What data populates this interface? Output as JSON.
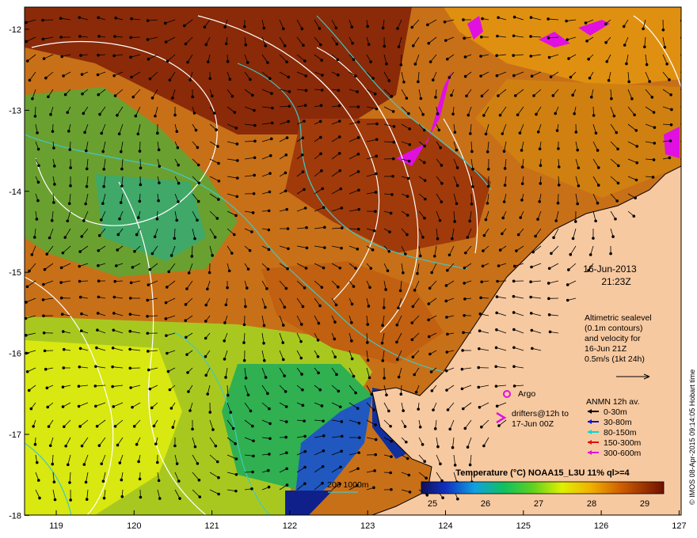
{
  "map": {
    "lon_ticks": [
      "119",
      "120",
      "121",
      "122",
      "123",
      "124",
      "125",
      "126",
      "127"
    ],
    "lat_ticks": [
      "-12",
      "-13",
      "-14",
      "-15",
      "-16",
      "-17",
      "-18"
    ],
    "date": "16-Jun-2013",
    "time": "21:23Z",
    "altimetry_note": [
      "Altimetric sealevel",
      "(0.1m contours)",
      "and velocity for",
      "16-Jun 21Z",
      "0.5m/s (1kt 24h)"
    ],
    "argo_label": "Argo",
    "drifters_label": [
      "drifters@12h to",
      "17-Jun 00Z"
    ],
    "anmn_title": "ANMN 12h av.",
    "anmn_legend": [
      {
        "label": "0-30m",
        "color": "#000000"
      },
      {
        "label": "30-80m",
        "color": "#1010d0"
      },
      {
        "label": "80-150m",
        "color": "#00d8d8"
      },
      {
        "label": "150-300m",
        "color": "#e01010"
      },
      {
        "label": "300-600m",
        "color": "#e010e0"
      }
    ],
    "isobath_label": "200  1000m",
    "colorbar_title": "Temperature (°C) NOAA15_L3U 11% ql>=4",
    "colorbar_ticks": [
      "25",
      "26",
      "27",
      "28",
      "29"
    ],
    "copyright": "© IMOS 08-Apr-2015 09:14:05 Hobart time",
    "colors": {
      "land": "#f7c9a0",
      "isobath": "#40c8c8",
      "contour": "#ffffff",
      "argo": "#e010e0"
    }
  }
}
